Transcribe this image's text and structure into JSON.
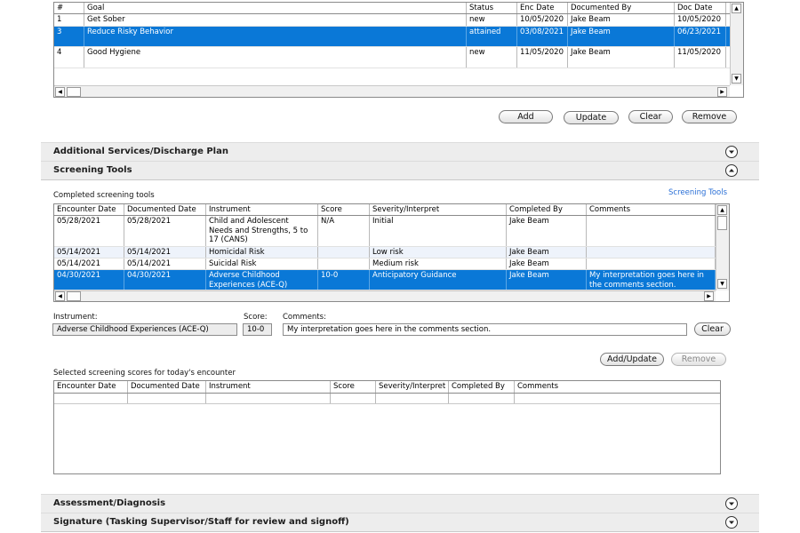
{
  "goals_table": {
    "columns": [
      "#",
      "Goal",
      "Status",
      "Enc Date",
      "Documented By",
      "Doc Date"
    ],
    "rows": [
      {
        "num": "1",
        "goal": "Get Sober",
        "status": "new",
        "enc_date": "10/05/2020",
        "documented_by": "Jake Beam",
        "doc_date": "10/05/2020",
        "selected": false
      },
      {
        "num": "3",
        "goal": "Reduce Risky Behavior",
        "status": "attained",
        "enc_date": "03/08/2021",
        "documented_by": "Jake Beam",
        "doc_date": "06/23/2021",
        "selected": true
      },
      {
        "num": "4",
        "goal": "Good Hygiene",
        "status": "new",
        "enc_date": "11/05/2020",
        "documented_by": "Jake Beam",
        "doc_date": "11/05/2020",
        "selected": false
      }
    ]
  },
  "goal_buttons": {
    "add": "Add",
    "update": "Update",
    "clear": "Clear",
    "remove": "Remove"
  },
  "sections": {
    "additional_services": "Additional Services/Discharge Plan",
    "screening_tools": "Screening Tools",
    "assessment": "Assessment/Diagnosis",
    "signature": "Signature (Tasking Supervisor/Staff for review and signoff)"
  },
  "screening": {
    "completed_label": "Completed screening tools",
    "link": "Screening Tools",
    "columns": [
      "Encounter Date",
      "Documented Date",
      "Instrument",
      "Score",
      "Severity/Interpret",
      "Completed By",
      "Comments"
    ],
    "rows": [
      {
        "encounter_date": "05/28/2021",
        "documented_date": "05/28/2021",
        "instrument": "Child and Adolescent Needs and Strengths, 5 to 17 (CANS)",
        "score": "N/A",
        "severity": "Initial",
        "completed_by": "Jake Beam",
        "comments": "",
        "selected": false
      },
      {
        "encounter_date": "05/14/2021",
        "documented_date": "05/14/2021",
        "instrument": "Homicidal Risk",
        "score": "",
        "severity": "Low risk",
        "completed_by": "Jake Beam",
        "comments": "",
        "selected": false
      },
      {
        "encounter_date": "05/14/2021",
        "documented_date": "05/14/2021",
        "instrument": "Suicidal Risk",
        "score": "",
        "severity": "Medium risk",
        "completed_by": "Jake Beam",
        "comments": "",
        "selected": false
      },
      {
        "encounter_date": "04/30/2021",
        "documented_date": "04/30/2021",
        "instrument": "Adverse Childhood Experiences (ACE-Q)",
        "score": "10-0",
        "severity": "Anticipatory Guidance",
        "completed_by": "Jake Beam",
        "comments": "My interpretation goes here in the comments section.",
        "selected": true
      }
    ],
    "form": {
      "instrument_label": "Instrument:",
      "instrument_value": "Adverse Childhood Experiences (ACE-Q)",
      "score_label": "Score:",
      "score_value": "10-0",
      "comments_label": "Comments:",
      "comments_value": "My interpretation goes here in the comments section.",
      "clear": "Clear",
      "add_update": "Add/Update",
      "remove": "Remove"
    },
    "selected_label": "Selected screening scores for today's encounter",
    "selected_columns": [
      "Encounter Date",
      "Documented Date",
      "Instrument",
      "Score",
      "Severity/Interpret",
      "Completed By",
      "Comments"
    ]
  }
}
